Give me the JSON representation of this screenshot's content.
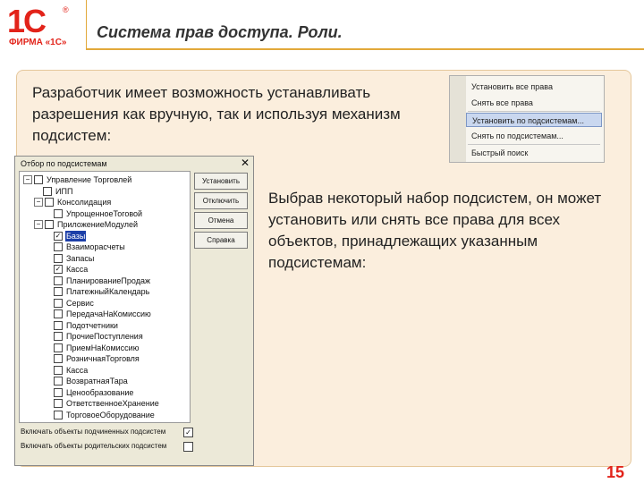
{
  "logo": {
    "mark": "1С",
    "registered": "®",
    "sub": "ФИРМА «1С»"
  },
  "slide": {
    "title": "Система прав доступа. Роли.",
    "intro": "Разработчик имеет возможность устанавливать разрешения как вручную, так и используя механизм подсистем:",
    "description": "Выбрав некоторый набор подсистем, он может установить или снять все права для всех объектов, принадлежащих указанным подсистемам:",
    "page_number": "15"
  },
  "menu": {
    "items": [
      {
        "label": "Установить все права",
        "selected": false
      },
      {
        "label": "Снять все права",
        "selected": false
      },
      {
        "label": "Установить по подсистемам...",
        "selected": true
      },
      {
        "label": "Снять по подсистемам...",
        "selected": false
      },
      {
        "label": "Быстрый поиск",
        "selected": false
      }
    ]
  },
  "dialog": {
    "title": "Отбор по подсистемам",
    "close": "✕",
    "tree": [
      {
        "label": "Управление Торговлей",
        "level": 0,
        "toggle": "−",
        "checked": false,
        "highlight": false
      },
      {
        "label": "ИПП",
        "level": 1,
        "toggle": "",
        "checked": false,
        "highlight": false
      },
      {
        "label": "Консолидация",
        "level": 1,
        "toggle": "−",
        "checked": false,
        "highlight": false
      },
      {
        "label": "УпрощенноеТоговой",
        "level": 2,
        "toggle": "",
        "checked": false,
        "highlight": false
      },
      {
        "label": "ПриложениеМодулей",
        "level": 1,
        "toggle": "−",
        "checked": false,
        "highlight": false
      },
      {
        "label": "Базы",
        "level": 2,
        "toggle": "",
        "checked": true,
        "highlight": true
      },
      {
        "label": "Взаиморасчеты",
        "level": 2,
        "toggle": "",
        "checked": false,
        "highlight": false
      },
      {
        "label": "Запасы",
        "level": 2,
        "toggle": "",
        "checked": false,
        "highlight": false
      },
      {
        "label": "Касса",
        "level": 2,
        "toggle": "",
        "checked": true,
        "highlight": false
      },
      {
        "label": "ПланированиеПродаж",
        "level": 2,
        "toggle": "",
        "checked": false,
        "highlight": false
      },
      {
        "label": "ПлатежныйКалендарь",
        "level": 2,
        "toggle": "",
        "checked": false,
        "highlight": false
      },
      {
        "label": "Сервис",
        "level": 2,
        "toggle": "",
        "checked": false,
        "highlight": false
      },
      {
        "label": "ПередачаНаКомиссию",
        "level": 2,
        "toggle": "",
        "checked": false,
        "highlight": false
      },
      {
        "label": "Подотчетники",
        "level": 2,
        "toggle": "",
        "checked": false,
        "highlight": false
      },
      {
        "label": "ПрочиеПоступления",
        "level": 2,
        "toggle": "",
        "checked": false,
        "highlight": false
      },
      {
        "label": "ПриемНаКомиссию",
        "level": 2,
        "toggle": "",
        "checked": false,
        "highlight": false
      },
      {
        "label": "РозничнаяТорговля",
        "level": 2,
        "toggle": "",
        "checked": false,
        "highlight": false
      },
      {
        "label": "Касса",
        "level": 2,
        "toggle": "",
        "checked": false,
        "highlight": false
      },
      {
        "label": "ВозвратнаяТара",
        "level": 2,
        "toggle": "",
        "checked": false,
        "highlight": false
      },
      {
        "label": "Ценообразование",
        "level": 2,
        "toggle": "",
        "checked": false,
        "highlight": false
      },
      {
        "label": "ОтветственноеХранение",
        "level": 2,
        "toggle": "",
        "checked": false,
        "highlight": false
      },
      {
        "label": "ТорговоеОборудование",
        "level": 2,
        "toggle": "",
        "checked": false,
        "highlight": false
      }
    ],
    "buttons": {
      "set": "Установить",
      "unset": "Отключить",
      "cancel": "Отмена",
      "help": "Справка"
    },
    "options": [
      {
        "label": "Включать объекты подчиненных подсистем",
        "checked": true
      },
      {
        "label": "Включать объекты родительских подсистем",
        "checked": false
      }
    ]
  }
}
